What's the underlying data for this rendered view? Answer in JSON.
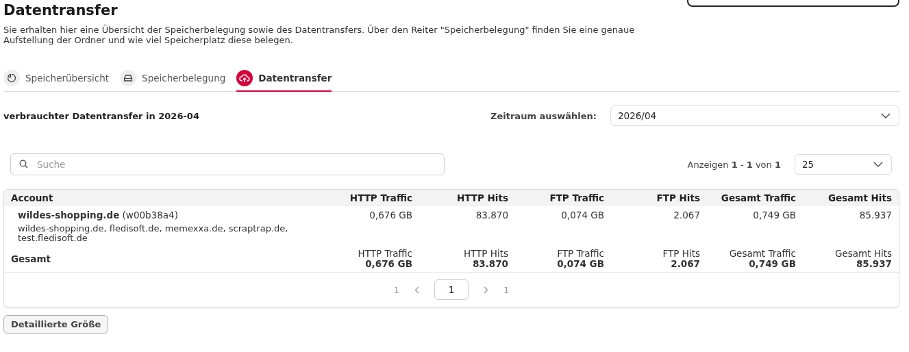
{
  "title": "Datentransfer",
  "description": "Sie erhalten hier eine Übersicht der Speicherbelegung sowie des Datentransfers. Über den Reiter \"Speicherbelegung\" finden Sie eine genaue Aufstellung der Ordner und wie viel Speicherplatz diese belegen.",
  "tabs": [
    {
      "label": "Speicherübersicht",
      "kind": "pie",
      "selected": false
    },
    {
      "label": "Speicherbelegung",
      "kind": "drive",
      "selected": false
    },
    {
      "label": "Datentransfer",
      "kind": "upload",
      "selected": true
    }
  ],
  "period": {
    "heading": "verbrauchter Datentransfer in 2026-04",
    "label": "Zeitraum auswählen:",
    "value": "2026/04"
  },
  "search": {
    "placeholder": "Suche"
  },
  "paging_info": "Anzeigen **1** - **1** von **1**",
  "page_size": "25",
  "table": {
    "columns": [
      "Account",
      "HTTP Traffic",
      "HTTP Hits",
      "FTP Traffic",
      "FTP Hits",
      "Gesamt Traffic",
      "Gesamt Hits"
    ],
    "rows": [
      {
        "account": "wildes-shopping.de",
        "account_id": "(w00b38a4)",
        "domains": "wildes-shopping.de, fledisoft.de, memexxa.de, scraptrap.de, test.fledisoft.de",
        "values": [
          "0,676 GB",
          "83.870",
          "0,074 GB",
          "2.067",
          "0,749 GB",
          "85.937"
        ]
      }
    ],
    "total": {
      "label": "Gesamt",
      "cells": [
        {
          "label": "HTTP Traffic",
          "value": "0,676 GB"
        },
        {
          "label": "HTTP Hits",
          "value": "83.870"
        },
        {
          "label": "FTP Traffic",
          "value": "0,074 GB"
        },
        {
          "label": "FTP Hits",
          "value": "2.067"
        },
        {
          "label": "Gesamt Traffic",
          "value": "0,749 GB"
        },
        {
          "label": "Gesamt Hits",
          "value": "85.937"
        }
      ]
    }
  },
  "pagination": {
    "first": "1",
    "current": "1",
    "last": "1"
  },
  "detail_button": "Detaillierte Größe"
}
